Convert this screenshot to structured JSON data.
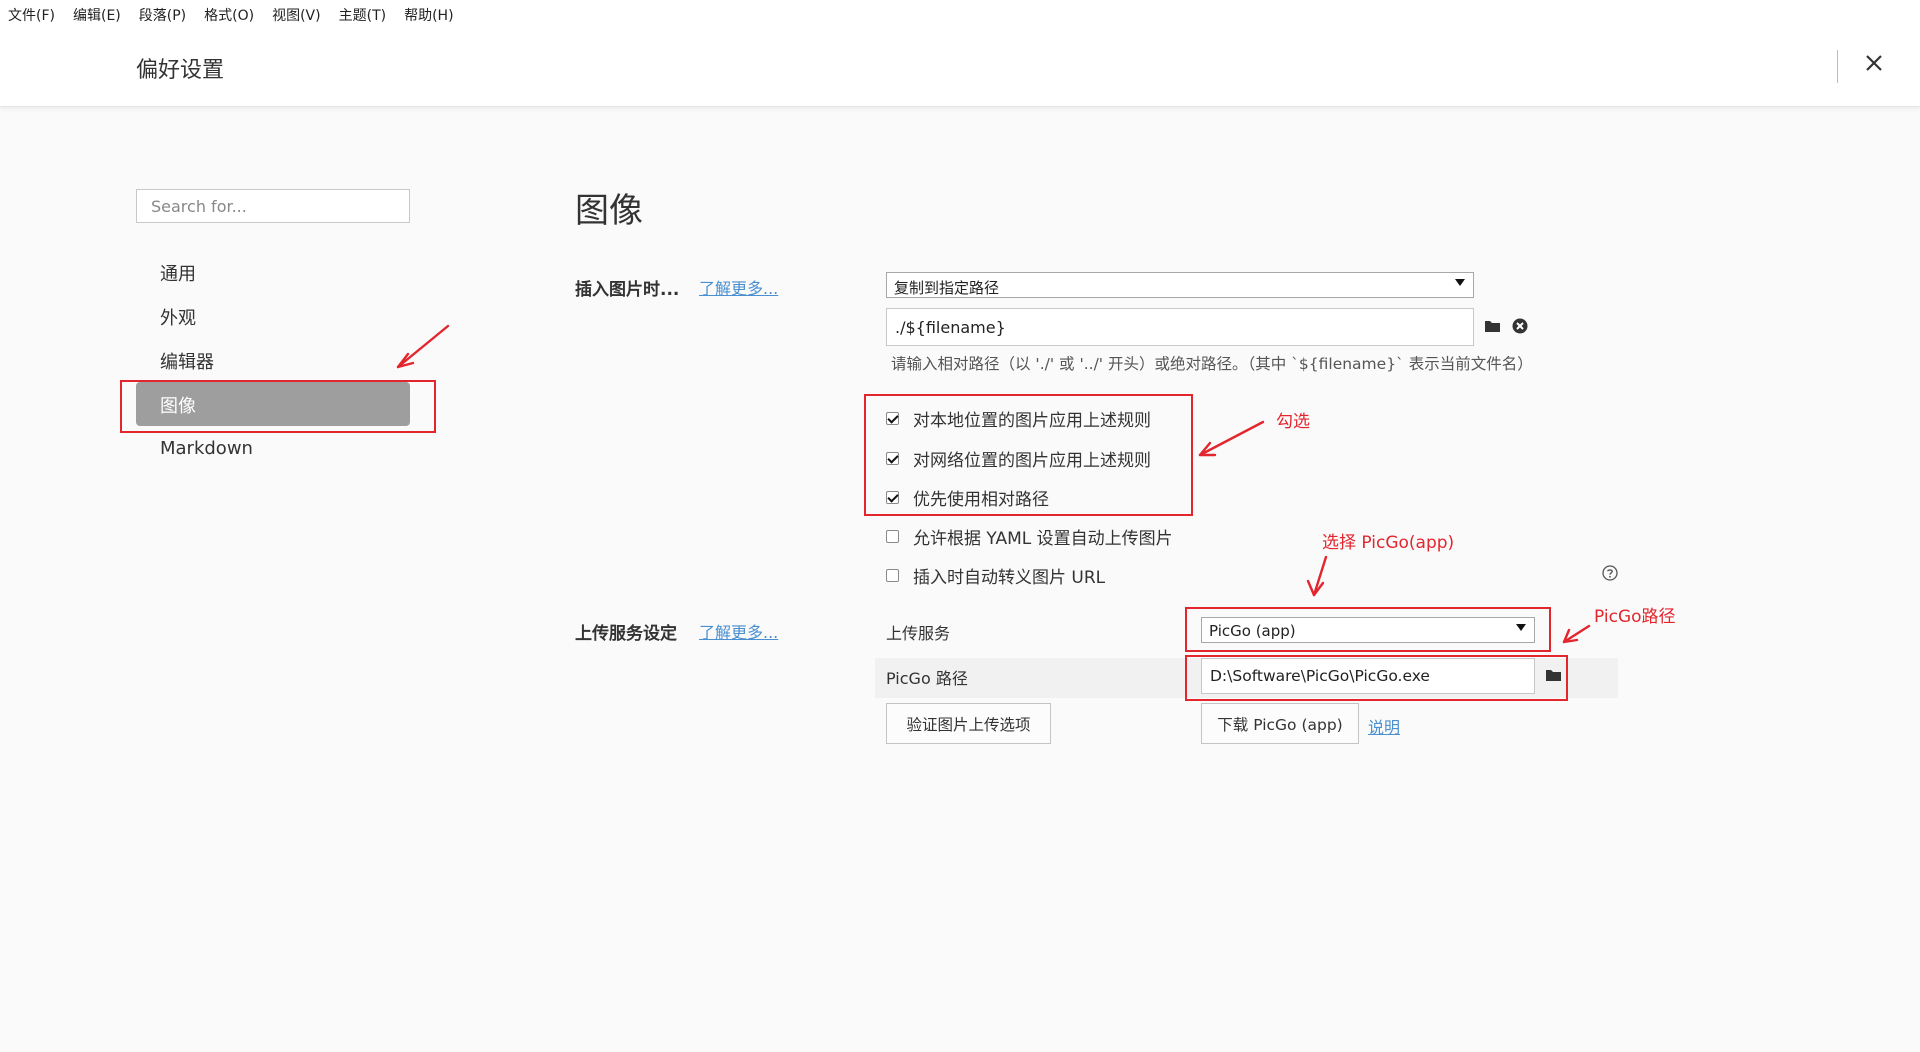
{
  "menubar": {
    "items": [
      "文件(F)",
      "编辑(E)",
      "段落(P)",
      "格式(O)",
      "视图(V)",
      "主题(T)",
      "帮助(H)"
    ]
  },
  "header": {
    "title": "偏好设置",
    "close_icon": "close-icon"
  },
  "sidebar": {
    "search_placeholder": "Search for...",
    "items": [
      "通用",
      "外观",
      "编辑器",
      "图像",
      "Markdown"
    ],
    "active_item": "图像"
  },
  "main": {
    "title": "图像",
    "insert_section": {
      "label": "插入图片时...",
      "learn_more": "了解更多...",
      "action_select": "复制到指定路径",
      "path_value": "./${filename}",
      "folder_icon": "folder-icon",
      "clear_icon": "clear-icon",
      "hint": "请输入相对路径（以 './' 或 '../' 开头）或绝对路径。（其中 `${filename}` 表示当前文件名）",
      "checkboxes": [
        {
          "label": "对本地位置的图片应用上述规则",
          "checked": true
        },
        {
          "label": "对网络位置的图片应用上述规则",
          "checked": true
        },
        {
          "label": "优先使用相对路径",
          "checked": true
        },
        {
          "label": "允许根据 YAML 设置自动上传图片",
          "checked": false
        },
        {
          "label": "插入时自动转义图片 URL",
          "checked": false
        }
      ],
      "help_icon": "help-icon"
    },
    "upload_section": {
      "label": "上传服务设定",
      "learn_more": "了解更多...",
      "service_label": "上传服务",
      "service_value": "PicGo (app)",
      "picgo_path_label": "PicGo 路径",
      "picgo_path_value": "D:\\Software\\PicGo\\PicGo.exe",
      "verify_button": "验证图片上传选项",
      "download_button": "下载 PicGo (app)",
      "explain_link": "说明"
    }
  },
  "annotations": {
    "color": "#e3262e",
    "check_note": "勾选",
    "select_note": "选择 PicGo(app)",
    "path_note": "PicGo路径"
  }
}
